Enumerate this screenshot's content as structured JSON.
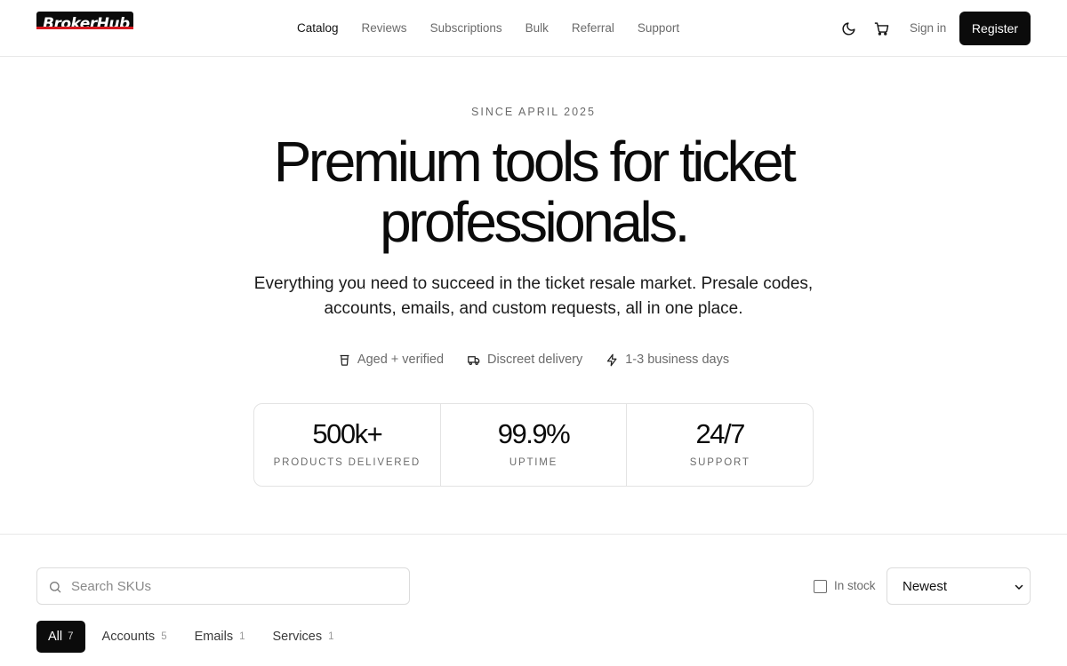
{
  "header": {
    "logo_text": "BrokerHub",
    "nav": [
      {
        "label": "Catalog",
        "active": true
      },
      {
        "label": "Reviews",
        "active": false
      },
      {
        "label": "Subscriptions",
        "active": false
      },
      {
        "label": "Bulk",
        "active": false
      },
      {
        "label": "Referral",
        "active": false
      },
      {
        "label": "Support",
        "active": false
      }
    ],
    "theme_icon": "moon-icon",
    "cart_icon": "cart-icon",
    "sign_in_label": "Sign in",
    "register_label": "Register"
  },
  "hero": {
    "eyebrow": "SINCE APRIL 2025",
    "headline_line1": "Premium tools for ticket",
    "headline_line2": "professionals.",
    "subtitle_line1": "Everything you need to succeed in the ticket resale market. Presale codes,",
    "subtitle_line2": "accounts, emails, and custom requests, all in one place.",
    "features": [
      {
        "icon": "trash-can-icon",
        "label": "Aged + verified"
      },
      {
        "icon": "truck-icon",
        "label": "Discreet delivery"
      },
      {
        "icon": "lightning-icon",
        "label": "1-3 business days"
      }
    ],
    "stats": [
      {
        "value": "500k+",
        "label": "PRODUCTS DELIVERED"
      },
      {
        "value": "99.9%",
        "label": "UPTIME"
      },
      {
        "value": "24/7",
        "label": "SUPPORT"
      }
    ]
  },
  "catalog": {
    "search_placeholder": "Search SKUs",
    "in_stock_label": "In stock",
    "in_stock_checked": false,
    "sort_selected": "Newest",
    "filters": [
      {
        "label": "All",
        "count": "7",
        "active": true
      },
      {
        "label": "Accounts",
        "count": "5",
        "active": false
      },
      {
        "label": "Emails",
        "count": "1",
        "active": false
      },
      {
        "label": "Services",
        "count": "1",
        "active": false
      }
    ]
  },
  "colors": {
    "primary": "#0b0b0b",
    "muted_text": "#6b6b6b",
    "border": "#e3e3e3",
    "logo_accent": "#d71920"
  }
}
